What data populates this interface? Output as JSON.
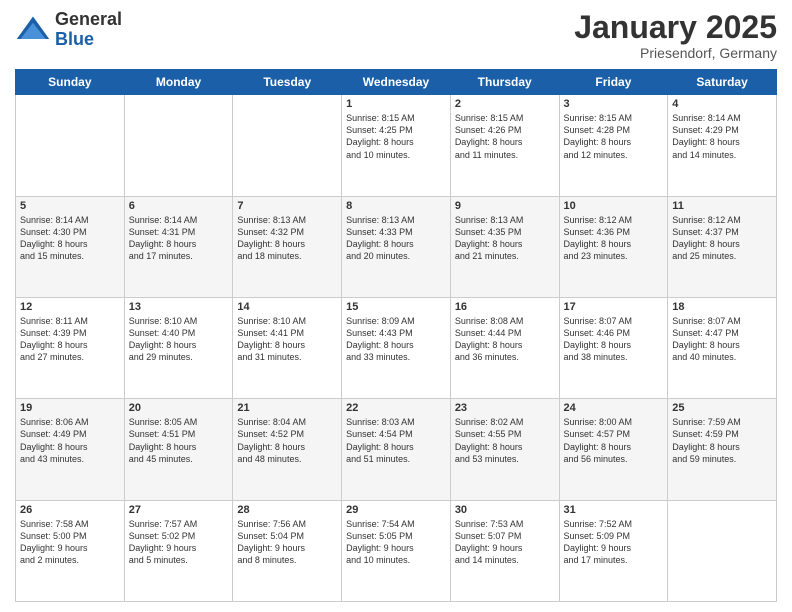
{
  "logo": {
    "general": "General",
    "blue": "Blue"
  },
  "header": {
    "month": "January 2025",
    "location": "Priesendorf, Germany"
  },
  "weekdays": [
    "Sunday",
    "Monday",
    "Tuesday",
    "Wednesday",
    "Thursday",
    "Friday",
    "Saturday"
  ],
  "weeks": [
    [
      {
        "day": "",
        "content": ""
      },
      {
        "day": "",
        "content": ""
      },
      {
        "day": "",
        "content": ""
      },
      {
        "day": "1",
        "content": "Sunrise: 8:15 AM\nSunset: 4:25 PM\nDaylight: 8 hours\nand 10 minutes."
      },
      {
        "day": "2",
        "content": "Sunrise: 8:15 AM\nSunset: 4:26 PM\nDaylight: 8 hours\nand 11 minutes."
      },
      {
        "day": "3",
        "content": "Sunrise: 8:15 AM\nSunset: 4:28 PM\nDaylight: 8 hours\nand 12 minutes."
      },
      {
        "day": "4",
        "content": "Sunrise: 8:14 AM\nSunset: 4:29 PM\nDaylight: 8 hours\nand 14 minutes."
      }
    ],
    [
      {
        "day": "5",
        "content": "Sunrise: 8:14 AM\nSunset: 4:30 PM\nDaylight: 8 hours\nand 15 minutes."
      },
      {
        "day": "6",
        "content": "Sunrise: 8:14 AM\nSunset: 4:31 PM\nDaylight: 8 hours\nand 17 minutes."
      },
      {
        "day": "7",
        "content": "Sunrise: 8:13 AM\nSunset: 4:32 PM\nDaylight: 8 hours\nand 18 minutes."
      },
      {
        "day": "8",
        "content": "Sunrise: 8:13 AM\nSunset: 4:33 PM\nDaylight: 8 hours\nand 20 minutes."
      },
      {
        "day": "9",
        "content": "Sunrise: 8:13 AM\nSunset: 4:35 PM\nDaylight: 8 hours\nand 21 minutes."
      },
      {
        "day": "10",
        "content": "Sunrise: 8:12 AM\nSunset: 4:36 PM\nDaylight: 8 hours\nand 23 minutes."
      },
      {
        "day": "11",
        "content": "Sunrise: 8:12 AM\nSunset: 4:37 PM\nDaylight: 8 hours\nand 25 minutes."
      }
    ],
    [
      {
        "day": "12",
        "content": "Sunrise: 8:11 AM\nSunset: 4:39 PM\nDaylight: 8 hours\nand 27 minutes."
      },
      {
        "day": "13",
        "content": "Sunrise: 8:10 AM\nSunset: 4:40 PM\nDaylight: 8 hours\nand 29 minutes."
      },
      {
        "day": "14",
        "content": "Sunrise: 8:10 AM\nSunset: 4:41 PM\nDaylight: 8 hours\nand 31 minutes."
      },
      {
        "day": "15",
        "content": "Sunrise: 8:09 AM\nSunset: 4:43 PM\nDaylight: 8 hours\nand 33 minutes."
      },
      {
        "day": "16",
        "content": "Sunrise: 8:08 AM\nSunset: 4:44 PM\nDaylight: 8 hours\nand 36 minutes."
      },
      {
        "day": "17",
        "content": "Sunrise: 8:07 AM\nSunset: 4:46 PM\nDaylight: 8 hours\nand 38 minutes."
      },
      {
        "day": "18",
        "content": "Sunrise: 8:07 AM\nSunset: 4:47 PM\nDaylight: 8 hours\nand 40 minutes."
      }
    ],
    [
      {
        "day": "19",
        "content": "Sunrise: 8:06 AM\nSunset: 4:49 PM\nDaylight: 8 hours\nand 43 minutes."
      },
      {
        "day": "20",
        "content": "Sunrise: 8:05 AM\nSunset: 4:51 PM\nDaylight: 8 hours\nand 45 minutes."
      },
      {
        "day": "21",
        "content": "Sunrise: 8:04 AM\nSunset: 4:52 PM\nDaylight: 8 hours\nand 48 minutes."
      },
      {
        "day": "22",
        "content": "Sunrise: 8:03 AM\nSunset: 4:54 PM\nDaylight: 8 hours\nand 51 minutes."
      },
      {
        "day": "23",
        "content": "Sunrise: 8:02 AM\nSunset: 4:55 PM\nDaylight: 8 hours\nand 53 minutes."
      },
      {
        "day": "24",
        "content": "Sunrise: 8:00 AM\nSunset: 4:57 PM\nDaylight: 8 hours\nand 56 minutes."
      },
      {
        "day": "25",
        "content": "Sunrise: 7:59 AM\nSunset: 4:59 PM\nDaylight: 8 hours\nand 59 minutes."
      }
    ],
    [
      {
        "day": "26",
        "content": "Sunrise: 7:58 AM\nSunset: 5:00 PM\nDaylight: 9 hours\nand 2 minutes."
      },
      {
        "day": "27",
        "content": "Sunrise: 7:57 AM\nSunset: 5:02 PM\nDaylight: 9 hours\nand 5 minutes."
      },
      {
        "day": "28",
        "content": "Sunrise: 7:56 AM\nSunset: 5:04 PM\nDaylight: 9 hours\nand 8 minutes."
      },
      {
        "day": "29",
        "content": "Sunrise: 7:54 AM\nSunset: 5:05 PM\nDaylight: 9 hours\nand 10 minutes."
      },
      {
        "day": "30",
        "content": "Sunrise: 7:53 AM\nSunset: 5:07 PM\nDaylight: 9 hours\nand 14 minutes."
      },
      {
        "day": "31",
        "content": "Sunrise: 7:52 AM\nSunset: 5:09 PM\nDaylight: 9 hours\nand 17 minutes."
      },
      {
        "day": "",
        "content": ""
      }
    ]
  ]
}
